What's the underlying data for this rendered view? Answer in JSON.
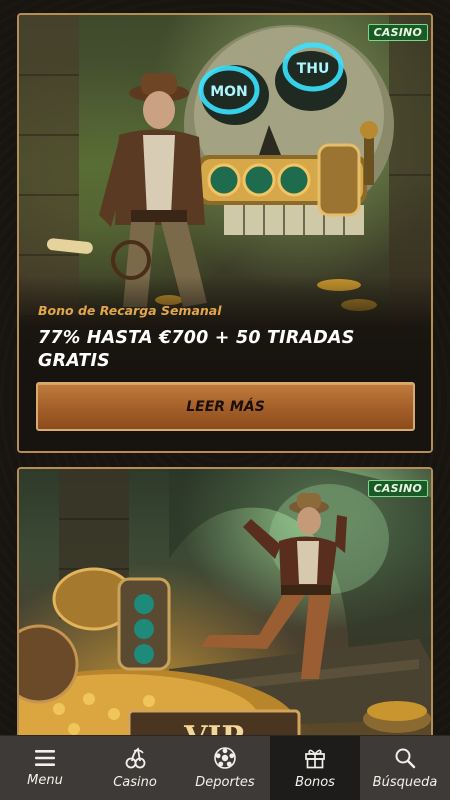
{
  "cards": [
    {
      "tag": "CASINO",
      "subtitle": "Bono de Recarga Semanal",
      "headline": "77% HASTA €700 + 50 TIRADAS GRATIS",
      "cta_label": "LEER MÁS",
      "slot_signs": [
        "MON",
        "THU"
      ]
    },
    {
      "tag": "CASINO",
      "plaque_text": "VIP"
    }
  ],
  "nav": {
    "items": [
      {
        "label": "Menu",
        "icon": "menu-icon"
      },
      {
        "label": "Casino",
        "icon": "cherries-icon"
      },
      {
        "label": "Deportes",
        "icon": "sports-ball-icon"
      },
      {
        "label": "Bonos",
        "icon": "gift-icon",
        "active": true
      },
      {
        "label": "Búsqueda",
        "icon": "search-icon"
      }
    ]
  },
  "colors": {
    "accent": "#b58d55",
    "cta": "#a35f29",
    "tag_bg": "#1a5a26",
    "subtitle": "#e3a64a"
  }
}
